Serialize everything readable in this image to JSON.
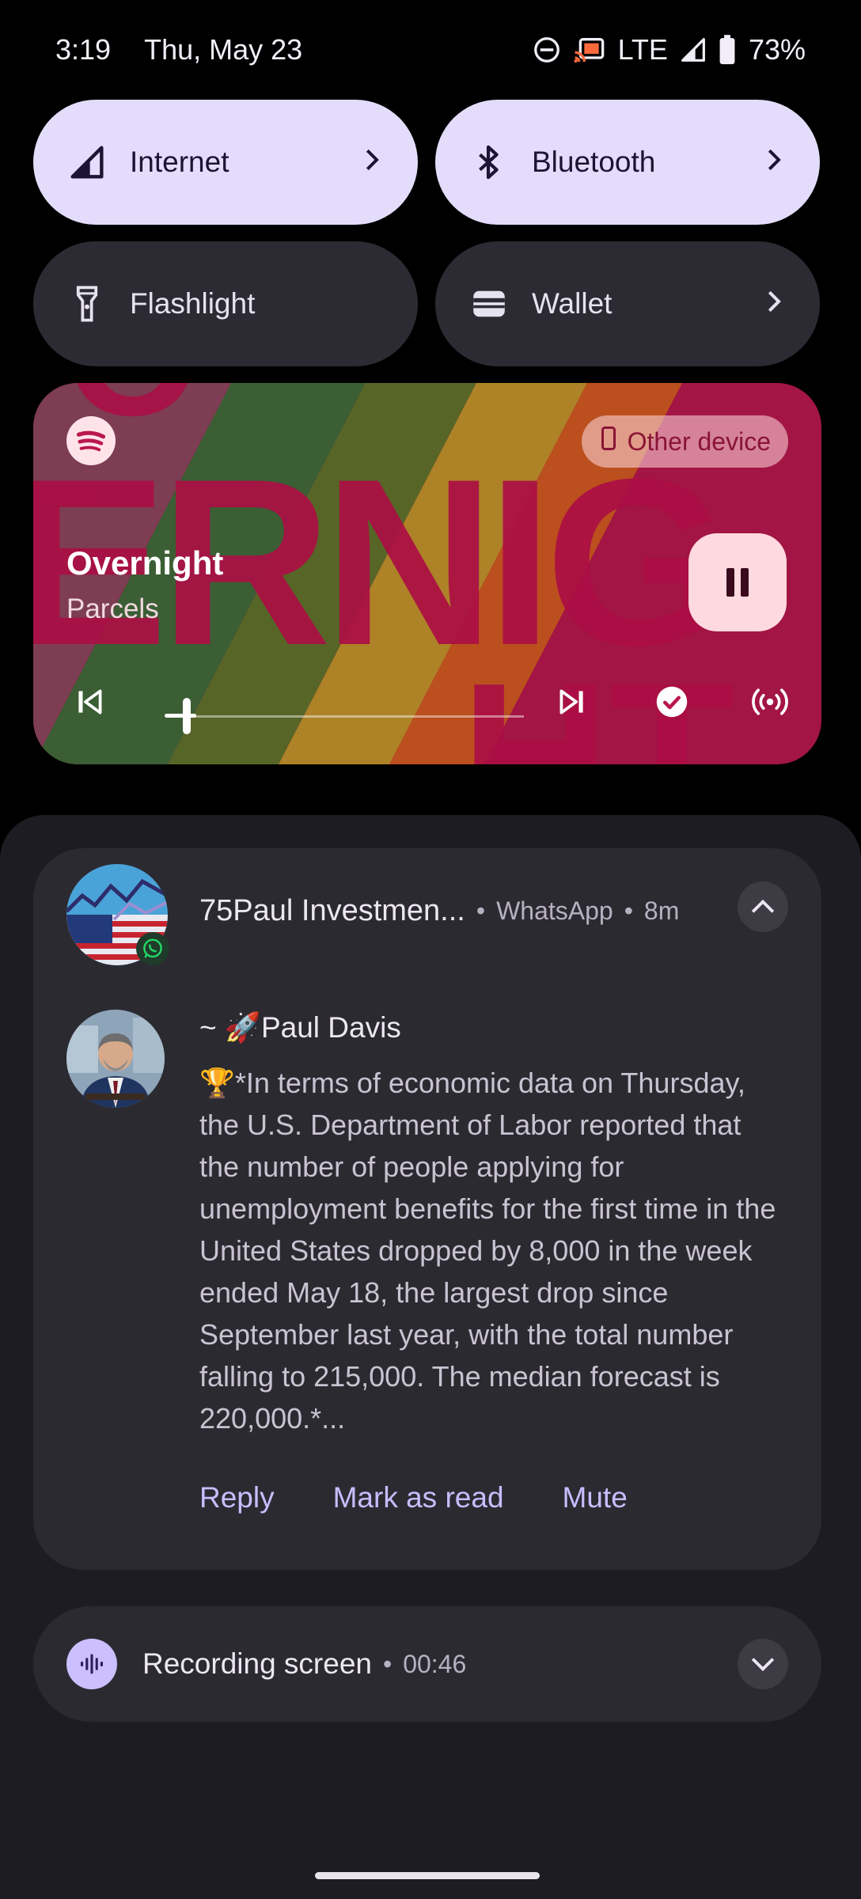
{
  "status_bar": {
    "time": "3:19",
    "date": "Thu, May 23",
    "network": "LTE",
    "battery": "73%"
  },
  "quick_tiles": [
    {
      "label": "Internet",
      "icon": "signal-icon",
      "active": true,
      "has_chevron": true
    },
    {
      "label": "Bluetooth",
      "icon": "bluetooth-icon",
      "active": true,
      "has_chevron": true
    },
    {
      "label": "Flashlight",
      "icon": "flashlight-icon",
      "active": false,
      "has_chevron": false
    },
    {
      "label": "Wallet",
      "icon": "wallet-icon",
      "active": false,
      "has_chevron": true
    }
  ],
  "media": {
    "app_icon": "spotify-icon",
    "output_device": "Other device",
    "song": "Overnight",
    "artist": "Parcels",
    "progress": 0.05,
    "accent": "#c2185b"
  },
  "notification": {
    "group_title": "75Paul Investmen...",
    "app": "WhatsApp",
    "time": "8m",
    "sender": "~ 🚀Paul Davis",
    "message": "🏆*In terms of economic data on Thursday, the U.S. Department of Labor reported that the number of people applying for unemployment benefits for the first time in the United States dropped by 8,000 in the week ended May 18, the largest drop since September last year, with the total number falling to 215,000. The median forecast is 220,000.*...",
    "actions": {
      "reply": "Reply",
      "mark_read": "Mark as read",
      "mute": "Mute"
    }
  },
  "recording": {
    "label": "Recording screen",
    "elapsed": "00:46"
  },
  "colors": {
    "tile_active": "#e3ddfb",
    "tile_inactive": "#2c2b33",
    "action_text": "#c8bdff"
  }
}
